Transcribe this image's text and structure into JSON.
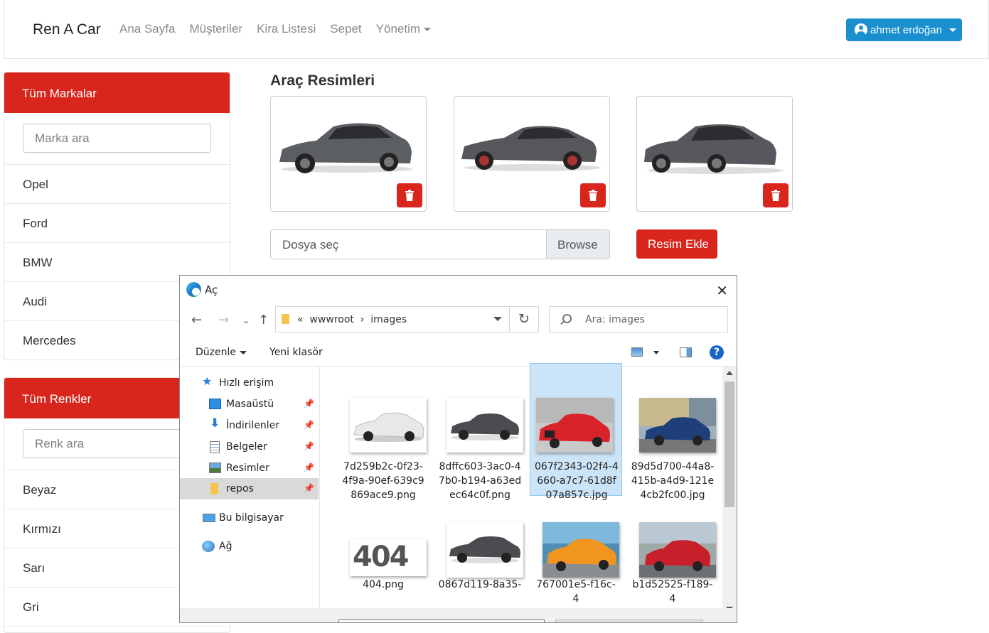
{
  "navbar": {
    "brand": "Ren A Car",
    "links": [
      "Ana Sayfa",
      "Müşteriler",
      "Kira Listesi",
      "Sepet",
      "Yönetim"
    ],
    "user": "ahmet erdoğan"
  },
  "brands_card": {
    "header": "Tüm Markalar",
    "search_placeholder": "Marka ara",
    "items": [
      "Opel",
      "Ford",
      "BMW",
      "Audi",
      "Mercedes"
    ]
  },
  "colors_card": {
    "header": "Tüm Renkler",
    "search_placeholder": "Renk ara",
    "items": [
      "Beyaz",
      "Kırmızı",
      "Sarı",
      "Gri"
    ]
  },
  "main": {
    "title": "Araç Resimleri",
    "images": [
      {
        "car_color": "#5b5e63"
      },
      {
        "car_color": "#55575b"
      },
      {
        "car_color": "#56585d"
      }
    ],
    "file_label": "Dosya seç",
    "browse_label": "Browse",
    "add_button": "Resim Ekle"
  },
  "dialog": {
    "title": "Aç",
    "path": [
      "wwwroot",
      "images"
    ],
    "search_placeholder": "Ara: images",
    "toolbar": {
      "organize": "Düzenle",
      "new_folder": "Yeni klasör"
    },
    "nav": [
      {
        "label": "Hızlı erişim",
        "icon": "star-icon"
      },
      {
        "label": "Masaüstü",
        "icon": "desktop-icon",
        "pinned": true
      },
      {
        "label": "İndirilenler",
        "icon": "download-icon",
        "pinned": true
      },
      {
        "label": "Belgeler",
        "icon": "document-icon",
        "pinned": true
      },
      {
        "label": "Resimler",
        "icon": "picture-icon",
        "pinned": true
      },
      {
        "label": "repos",
        "icon": "folder-icon",
        "pinned": true,
        "selected": true
      },
      {
        "label": "Bu bilgisayar",
        "icon": "computer-icon"
      },
      {
        "label": "Ağ",
        "icon": "network-icon"
      }
    ],
    "files": [
      {
        "name": "7d259b2c-0f23-4f9a-90ef-639c9869ace9.png",
        "color": "#e8e8e8",
        "bg": "#ffffff"
      },
      {
        "name": "8dffc603-3ac0-47b0-b194-a63edec64c0f.png",
        "color": "#4a4c50",
        "bg": "#ffffff"
      },
      {
        "name": "067f2343-02f4-4660-a7c7-61d8f07a857c.jpg",
        "color": "#d8232a",
        "bg": "#c9c9c9",
        "selected": true
      },
      {
        "name": "89d5d700-44a8-415b-a4d9-121e4cb2fc00.jpg",
        "color": "#1f3f7a",
        "bg": "#9fb1bd"
      },
      {
        "name": "404.png",
        "thumb_text": "404",
        "color": "#555555",
        "bg": "#ffffff"
      },
      {
        "name": "0867d119-8a35-",
        "color": "#4a4c50",
        "bg": "#ffffff"
      },
      {
        "name": "767001e5-f16c-4",
        "color": "#f2951f",
        "bg": "#4f8db6"
      },
      {
        "name": "b1d52525-f189-4",
        "color": "#c7202a",
        "bg": "#9fa9a5"
      }
    ]
  }
}
